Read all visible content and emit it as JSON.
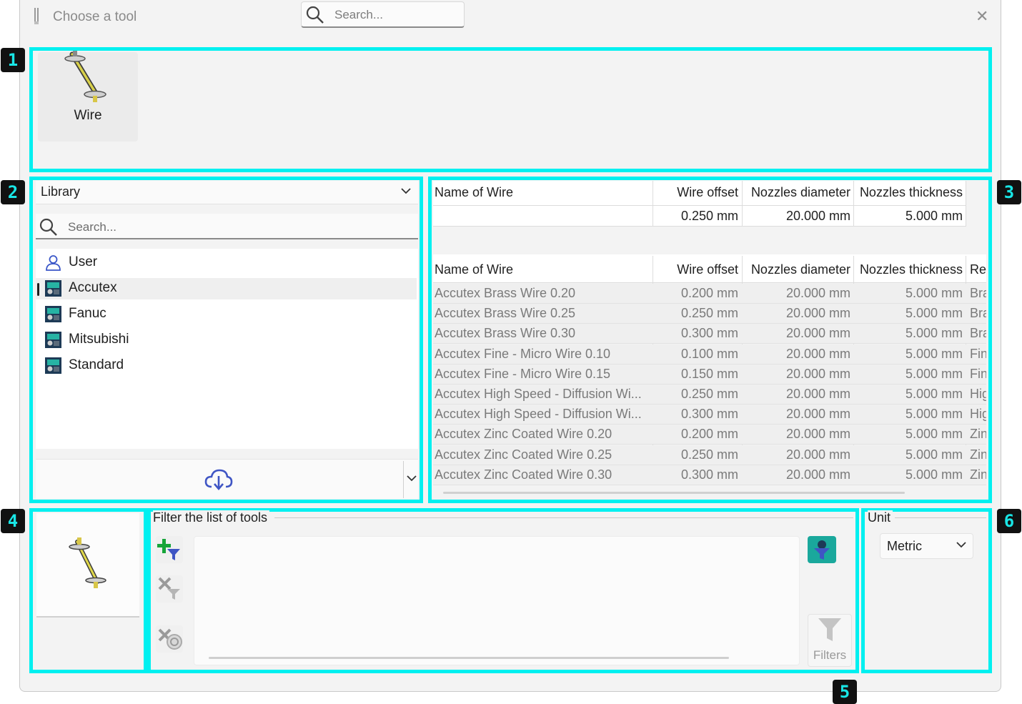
{
  "window": {
    "title": "Choose a tool",
    "search_placeholder": "Search..."
  },
  "badges": [
    "1",
    "2",
    "3",
    "4",
    "5",
    "6"
  ],
  "tool_types": [
    {
      "label": "Wire",
      "icon": "wire-tool-icon"
    }
  ],
  "library": {
    "select_label": "Library",
    "search_placeholder": "Search...",
    "items": [
      {
        "label": "User",
        "icon": "user-icon"
      },
      {
        "label": "Accutex",
        "icon": "machine-library-icon",
        "selected": true
      },
      {
        "label": "Fanuc",
        "icon": "machine-library-icon"
      },
      {
        "label": "Mitsubishi",
        "icon": "machine-library-icon"
      },
      {
        "label": "Standard",
        "icon": "machine-library-icon"
      }
    ],
    "bottom_icon": "cloud-download-icon"
  },
  "filter_row": {
    "headers": [
      "Name of Wire",
      "Wire offset",
      "Nozzles diameter",
      "Nozzles thickness"
    ],
    "values": [
      "",
      "0.250 mm",
      "20.000 mm",
      "5.000 mm"
    ]
  },
  "tools_table": {
    "headers": [
      "Name of Wire",
      "Wire offset",
      "Nozzles diameter",
      "Nozzles thickness",
      "Re"
    ],
    "rows": [
      [
        "Accutex Brass Wire 0.20",
        "0.200 mm",
        "20.000 mm",
        "5.000 mm",
        "Bra"
      ],
      [
        "Accutex Brass Wire 0.25",
        "0.250 mm",
        "20.000 mm",
        "5.000 mm",
        "Bra"
      ],
      [
        "Accutex Brass Wire 0.30",
        "0.300 mm",
        "20.000 mm",
        "5.000 mm",
        "Bra"
      ],
      [
        "Accutex Fine - Micro Wire 0.10",
        "0.100 mm",
        "20.000 mm",
        "5.000 mm",
        "Fin"
      ],
      [
        "Accutex Fine - Micro Wire 0.15",
        "0.150 mm",
        "20.000 mm",
        "5.000 mm",
        "Fin"
      ],
      [
        "Accutex High Speed - Diffusion Wi...",
        "0.250 mm",
        "20.000 mm",
        "5.000 mm",
        "Hig"
      ],
      [
        "Accutex High Speed - Diffusion Wi...",
        "0.300 mm",
        "20.000 mm",
        "5.000 mm",
        "Hig"
      ],
      [
        "Accutex Zinc Coated Wire 0.20",
        "0.200 mm",
        "20.000 mm",
        "5.000 mm",
        "Zin"
      ],
      [
        "Accutex Zinc Coated Wire 0.25",
        "0.250 mm",
        "20.000 mm",
        "5.000 mm",
        "Zin"
      ],
      [
        "Accutex Zinc Coated Wire 0.30",
        "0.300 mm",
        "20.000 mm",
        "5.000 mm",
        "Zin"
      ]
    ]
  },
  "filter_section": {
    "legend": "Filter the list of tools",
    "filters_button": "Filters",
    "buttons": [
      "add-filter-icon",
      "remove-filter-icon",
      "clear-filters-icon",
      "toggle-filter-icon",
      "funnel-icon"
    ]
  },
  "unit_section": {
    "legend": "Unit",
    "value": "Metric"
  },
  "colors": {
    "annotation": "#00f0f0",
    "accent": "#1aa89c",
    "badge_bg": "#111111"
  }
}
